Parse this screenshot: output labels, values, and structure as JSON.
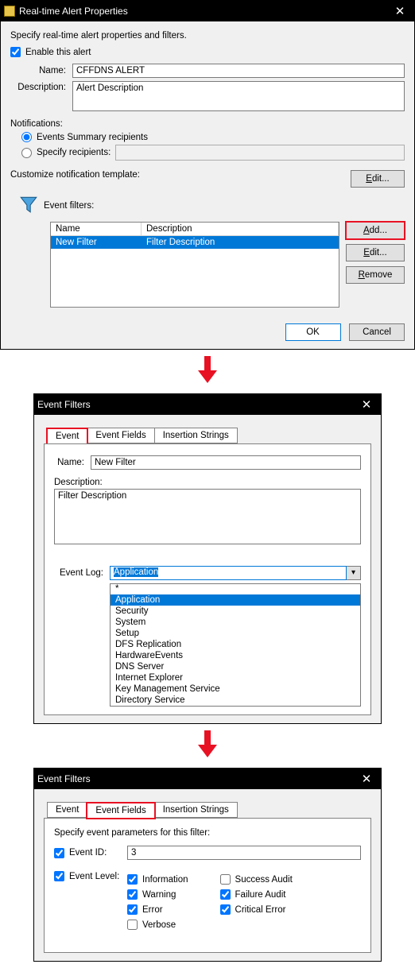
{
  "dialog1": {
    "title": "Real-time Alert Properties",
    "prompt": "Specify real-time alert properties and filters.",
    "enable_label": "Enable this alert",
    "enable_checked": true,
    "name_label": "Name:",
    "name_value": "CFFDNS ALERT",
    "desc_label": "Description:",
    "desc_value": "Alert Description",
    "notifications_label": "Notifications:",
    "radio_summary": "Events Summary recipients",
    "radio_specify": "Specify recipients:",
    "customize_label": "Customize notification template:",
    "edit_btn": "Edit...",
    "event_filters_label": "Event filters:",
    "table": {
      "col_name": "Name",
      "col_desc": "Description",
      "rows": [
        {
          "name": "New Filter",
          "desc": "Filter Description"
        }
      ]
    },
    "btn_add": "Add...",
    "btn_edit": "Edit...",
    "btn_remove": "Remove",
    "btn_ok": "OK",
    "btn_cancel": "Cancel"
  },
  "dialog2": {
    "title": "Event Filters",
    "tabs": [
      "Event",
      "Event Fields",
      "Insertion Strings"
    ],
    "active_tab": 0,
    "name_label": "Name:",
    "name_value": "New Filter",
    "desc_label": "Description:",
    "desc_value": "Filter Description",
    "log_label": "Event Log:",
    "log_selected": "Application",
    "log_options": [
      "*",
      "Application",
      "Security",
      "System",
      "Setup",
      "DFS Replication",
      "HardwareEvents",
      "DNS Server",
      "Internet Explorer",
      "Key Management Service",
      "Directory Service"
    ]
  },
  "dialog3": {
    "title": "Event Filters",
    "tabs": [
      "Event",
      "Event Fields",
      "Insertion Strings"
    ],
    "active_tab": 1,
    "prompt": "Specify event parameters for this filter:",
    "event_id_label": "Event ID:",
    "event_id_value": "3",
    "event_level_label": "Event Level:",
    "levels_col1": [
      {
        "label": "Information",
        "checked": true
      },
      {
        "label": "Warning",
        "checked": true
      },
      {
        "label": "Error",
        "checked": true
      },
      {
        "label": "Verbose",
        "checked": false
      }
    ],
    "levels_col2": [
      {
        "label": "Success Audit",
        "checked": false
      },
      {
        "label": "Failure Audit",
        "checked": true
      },
      {
        "label": "Critical Error",
        "checked": true
      }
    ]
  }
}
